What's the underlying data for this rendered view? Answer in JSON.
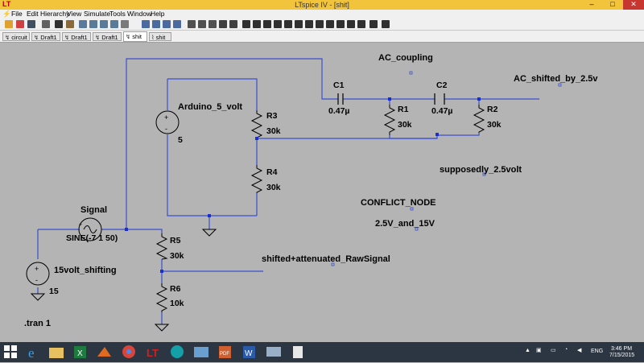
{
  "window": {
    "title": "LTspice IV - [shit]",
    "app_icon": "LT"
  },
  "menu": [
    "File",
    "Edit",
    "Hierarchy",
    "View",
    "Simulate",
    "Tools",
    "Window",
    "Help"
  ],
  "tabs": [
    "circuit",
    "Draft1",
    "Draft1",
    "Draft1",
    "shit",
    "shit"
  ],
  "active_tab_index": 4,
  "schematic": {
    "net_labels": {
      "ac_coupling": "AC_coupling",
      "ac_shifted": "AC_shifted_by_2.5v",
      "supposedly": "supposedly_2.5volt",
      "conflict": "CONFLICT_NODE",
      "conflict_value": "2.5V_and_15V",
      "shifted_raw": "shifted+attenuated_RawSignal"
    },
    "components": {
      "arduino": {
        "name": "Arduino_5_volt",
        "value": "5"
      },
      "signal": {
        "name": "Signal",
        "value": "SINE(-7 1 50)"
      },
      "shift": {
        "name": "15volt_shifting",
        "value": "15"
      },
      "c1": {
        "name": "C1",
        "value": "0.47µ"
      },
      "c2": {
        "name": "C2",
        "value": "0.47µ"
      },
      "r1": {
        "name": "R1",
        "value": "30k"
      },
      "r2": {
        "name": "R2",
        "value": "30k"
      },
      "r3": {
        "name": "R3",
        "value": "30k"
      },
      "r4": {
        "name": "R4",
        "value": "30k"
      },
      "r5": {
        "name": "R5",
        "value": "30k"
      },
      "r6": {
        "name": "R6",
        "value": "10k"
      }
    },
    "directive": ".tran 1",
    "wire_color": "#3a4fcf",
    "background_color": "#b4b4b4"
  },
  "taskbar": {
    "language": "ENG",
    "time": "3:46 PM",
    "date": "7/15/2015",
    "apps": [
      "start-icon",
      "ie-icon",
      "explorer-icon",
      "excel-icon",
      "matlab-icon",
      "chrome-icon",
      "ltspice-icon",
      "arduino-icon",
      "photos-icon",
      "pdf-icon",
      "word-icon",
      "remote-icon",
      "notepad-icon"
    ]
  }
}
